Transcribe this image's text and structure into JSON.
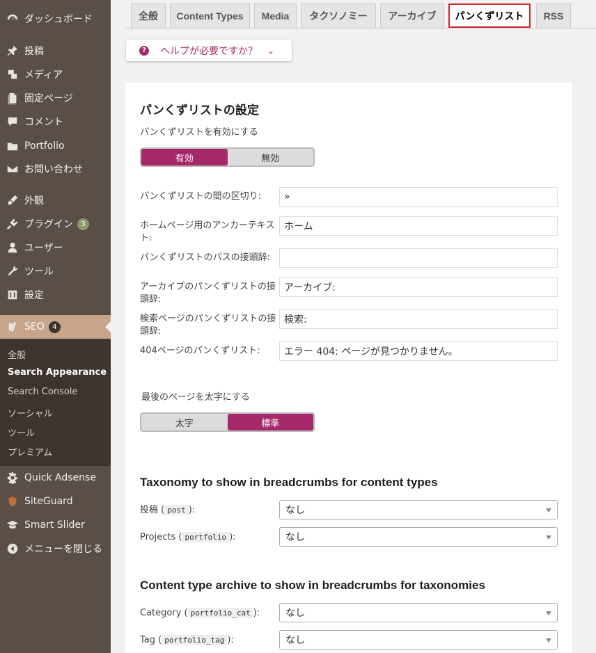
{
  "sidebar": {
    "items": [
      {
        "label": "ダッシュボード",
        "icon": "dashboard-icon"
      },
      {
        "label": "投稿",
        "icon": "pin-icon"
      },
      {
        "label": "メディア",
        "icon": "media-icon"
      },
      {
        "label": "固定ページ",
        "icon": "page-icon"
      },
      {
        "label": "コメント",
        "icon": "comment-icon"
      },
      {
        "label": "Portfolio",
        "icon": "folder-icon"
      },
      {
        "label": "お問い合わせ",
        "icon": "mail-icon"
      },
      {
        "label": "外観",
        "icon": "brush-icon"
      },
      {
        "label": "プラグイン",
        "icon": "plugin-icon",
        "badge": "3"
      },
      {
        "label": "ユーザー",
        "icon": "user-icon"
      },
      {
        "label": "ツール",
        "icon": "wrench-icon"
      },
      {
        "label": "設定",
        "icon": "settings-icon"
      },
      {
        "label": "SEO",
        "icon": "yoast-icon",
        "badge": "4"
      },
      {
        "label": "Quick Adsense",
        "icon": "gear-icon"
      },
      {
        "label": "SiteGuard",
        "icon": "shield-icon"
      },
      {
        "label": "Smart Slider",
        "icon": "mortarboard-icon"
      },
      {
        "label": "メニューを閉じる",
        "icon": "collapse-icon"
      }
    ],
    "submenu": [
      "全般",
      "Search Appearance",
      "Search Console",
      "ソーシャル",
      "ツール",
      "プレミアム"
    ]
  },
  "tabs": [
    "全般",
    "Content Types",
    "Media",
    "タクソノミー",
    "アーカイブ",
    "パンくずリスト",
    "RSS"
  ],
  "help": {
    "label": "ヘルプが必要ですか？"
  },
  "settings": {
    "title": "パンくずリストの設定",
    "enable_label": "パンくずリストを有効にする",
    "enable_on": "有効",
    "enable_off": "無効",
    "fields": [
      {
        "label": "パンくずリストの間の区切り:",
        "value": "»"
      },
      {
        "label": "ホームページ用のアンカーテキスト:",
        "value": "ホーム"
      },
      {
        "label": "パンくずリストのパスの接頭辞:",
        "value": ""
      },
      {
        "label": "アーカイブのパンくずリストの接頭辞:",
        "value": "アーカイブ:"
      },
      {
        "label": "検索ページのパンくずリストの接頭辞:",
        "value": "検索:"
      },
      {
        "label": "404ページのパンくずリスト:",
        "value": "エラー 404: ページが見つかりません。"
      }
    ],
    "bold_label": "最後のページを太字にする",
    "bold_on": "太字",
    "bold_off": "標準"
  },
  "taxonomy_section": {
    "title": "Taxonomy to show in breadcrumbs for content types",
    "rows": [
      {
        "label": "投稿 (",
        "code": "post",
        "suffix": "):",
        "value": "なし"
      },
      {
        "label": "Projects (",
        "code": "portfolio",
        "suffix": "):",
        "value": "なし"
      }
    ]
  },
  "archive_section": {
    "title": "Content type archive to show in breadcrumbs for taxonomies",
    "rows": [
      {
        "label": "Category (",
        "code": "portfolio_cat",
        "suffix": "):",
        "value": "なし"
      },
      {
        "label": "Tag (",
        "code": "portfolio_tag",
        "suffix": "):",
        "value": "なし"
      }
    ]
  },
  "colors": {
    "sidebar": "#5a4f46",
    "accent": "#a4286a",
    "current": "#c7a58a",
    "highlight": "#d0262f"
  }
}
